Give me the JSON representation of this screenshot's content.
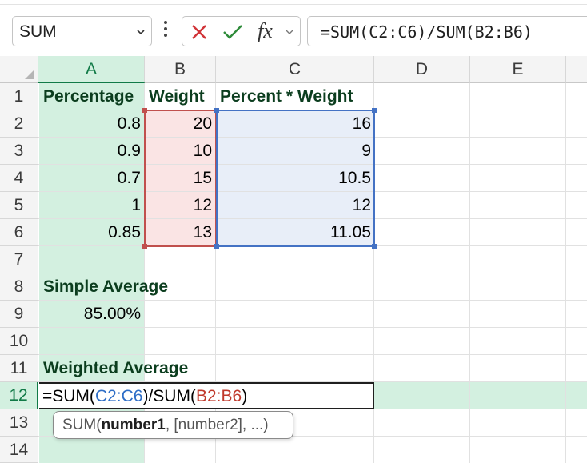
{
  "formula_bar": {
    "name_box": "SUM",
    "fx_label": "fx",
    "formula": "=SUM(C2:C6)/SUM(B2:B6)"
  },
  "columns": [
    "A",
    "B",
    "C",
    "D",
    "E"
  ],
  "rows": [
    "1",
    "2",
    "3",
    "4",
    "5",
    "6",
    "7",
    "8",
    "9",
    "10",
    "11",
    "12",
    "13",
    "14"
  ],
  "cells": {
    "A1": "Percentage",
    "B1": "Weight",
    "C1": "Percent * Weight",
    "A2": "0.8",
    "B2": "20",
    "C2": "16",
    "A3": "0.9",
    "B3": "10",
    "C3": "9",
    "A4": "0.7",
    "B4": "15",
    "C4": "10.5",
    "A5": "1",
    "B5": "12",
    "C5": "12",
    "A6": "0.85",
    "B6": "13",
    "C6": "11.05",
    "A8": "Simple Average",
    "A9": "85.00%",
    "A11": "Weighted Average"
  },
  "editing": {
    "cell": "A12",
    "parts": [
      "=SUM(",
      "C2:C6",
      ")/SUM(",
      "B2:B6",
      ")"
    ]
  },
  "tooltip": {
    "fn": "SUM(",
    "arg1": "number1",
    "rest": ", [number2], ...)"
  },
  "colors": {
    "selection_green": "#117a47",
    "selection_fill": "#d3f0e0",
    "range_red": "#c0504d",
    "range_blue": "#4472c4"
  }
}
